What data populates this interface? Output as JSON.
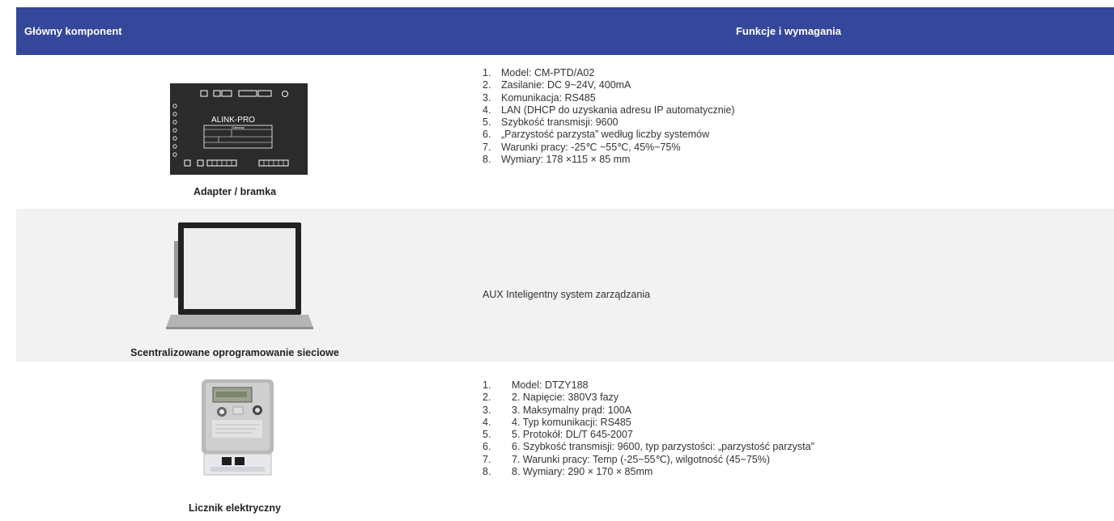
{
  "header": {
    "col_left": "Główny komponent",
    "col_right": "Funkcje i wymagania"
  },
  "rows": [
    {
      "caption": "Adapter / bramka",
      "image": {
        "brand_text": "ALINK-PRO",
        "sub_text": "Gateway",
        "icon": "gateway-device-image"
      },
      "items": [
        {
          "num": "1.",
          "text": "Model: CM-PTD/A02"
        },
        {
          "num": "2.",
          "text": "Zasilanie: DC 9~24V, 400mA"
        },
        {
          "num": "3.",
          "text": "Komunikacja: RS485"
        },
        {
          "num": "4.",
          "text": "LAN (DHCP do uzyskania adresu IP automatycznie)"
        },
        {
          "num": "5.",
          "text": "Szybkość transmisji: 9600"
        },
        {
          "num": "6.",
          "text": "„Parzystość parzysta” według liczby systemów"
        },
        {
          "num": "7.",
          "text": "Warunki pracy: -25℃ ~55℃, 45%~75%"
        },
        {
          "num": "8.",
          "text": "Wymiary: 178 ×115  × 85 mm"
        }
      ]
    },
    {
      "caption": "Scentralizowane oprogramowanie sieciowe",
      "image": {
        "icon": "laptop-image"
      },
      "text": "AUX Inteligentny system zarządzania"
    },
    {
      "caption": "Licznik elektryczny",
      "image": {
        "icon": "electricity-meter-image"
      },
      "items": [
        {
          "num": "1.",
          "text": "Model: DTZY188"
        },
        {
          "num": "2.",
          "text": "2. Napięcie: 380V3 fazy"
        },
        {
          "num": "3.",
          "text": "3. Maksymalny prąd: 100A"
        },
        {
          "num": "4.",
          "text": "4. Typ komunikacji: RS485"
        },
        {
          "num": "5.",
          "text": "5. Protokół: DL/T 645-2007"
        },
        {
          "num": "6.",
          "text": "6. Szybkość transmisji: 9600, typ parzystości: „parzystość parzysta”"
        },
        {
          "num": "7.",
          "text": "7. Warunki pracy: Temp (-25~55℃), wilgotność (45~75%)"
        },
        {
          "num": "8.",
          "text": "8. Wymiary: 290 × 170 × 85mm"
        }
      ]
    }
  ]
}
